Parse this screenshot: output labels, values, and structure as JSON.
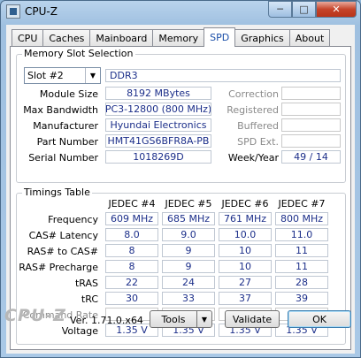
{
  "window": {
    "title": "CPU-Z"
  },
  "tabs": [
    "CPU",
    "Caches",
    "Mainboard",
    "Memory",
    "SPD",
    "Graphics",
    "About"
  ],
  "active_tab": "SPD",
  "slot_group": {
    "title": "Memory Slot Selection",
    "slot_value": "Slot #2",
    "module_type": "DDR3",
    "labels": {
      "module_size": "Module Size",
      "max_bandwidth": "Max Bandwidth",
      "manufacturer": "Manufacturer",
      "part_number": "Part Number",
      "serial_number": "Serial Number",
      "correction": "Correction",
      "registered": "Registered",
      "buffered": "Buffered",
      "spd_ext": "SPD Ext.",
      "week_year": "Week/Year"
    },
    "values": {
      "module_size": "8192 MBytes",
      "max_bandwidth": "PC3-12800 (800 MHz)",
      "manufacturer": "Hyundai Electronics",
      "part_number": "HMT41GS6BFR8A-PB",
      "serial_number": "1018269D",
      "week_year": "49 / 14"
    }
  },
  "timings": {
    "title": "Timings Table",
    "columns": [
      "JEDEC #4",
      "JEDEC #5",
      "JEDEC #6",
      "JEDEC #7"
    ],
    "rows": [
      {
        "label": "Frequency",
        "values": [
          "609 MHz",
          "685 MHz",
          "761 MHz",
          "800 MHz"
        ]
      },
      {
        "label": "CAS# Latency",
        "values": [
          "8.0",
          "9.0",
          "10.0",
          "11.0"
        ]
      },
      {
        "label": "RAS# to CAS#",
        "values": [
          "8",
          "9",
          "10",
          "11"
        ]
      },
      {
        "label": "RAS# Precharge",
        "values": [
          "8",
          "9",
          "10",
          "11"
        ]
      },
      {
        "label": "tRAS",
        "values": [
          "22",
          "24",
          "27",
          "28"
        ]
      },
      {
        "label": "tRC",
        "values": [
          "30",
          "33",
          "37",
          "39"
        ]
      },
      {
        "label": "Command Rate",
        "values": [
          "",
          "",
          "",
          ""
        ]
      },
      {
        "label": "Voltage",
        "values": [
          "1.35 V",
          "1.35 V",
          "1.35 V",
          "1.35 V"
        ]
      }
    ]
  },
  "footer": {
    "logo": "CPU-Z",
    "version": "Ver. 1.71.0.x64",
    "tools_label": "Tools",
    "validate_label": "Validate",
    "ok_label": "OK"
  }
}
